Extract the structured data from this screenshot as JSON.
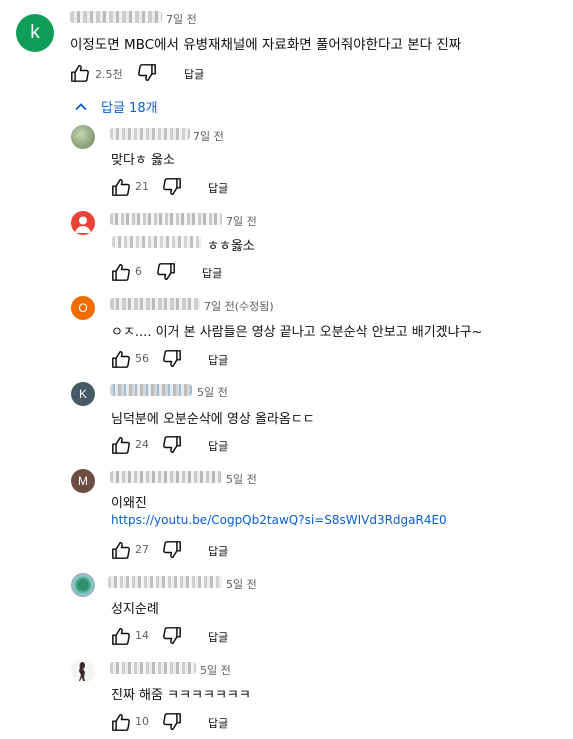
{
  "colors": {
    "link": "#065fd4",
    "meta_text": "#606060",
    "avatar_k_main": "#0f9d58",
    "avatar_red": "#ea4335",
    "avatar_o": "#ef6c00",
    "avatar_k_reply": "#455a64",
    "avatar_m": "#6d4c41"
  },
  "main_comment": {
    "avatar_letter": "k",
    "time": "7일 전",
    "text": "이정도면 MBC에서 유병재채널에 자료화면 풀어줘야한다고 본다 진짜",
    "likes": "2.5천",
    "reply_label": "답글",
    "icons": [
      "thumb-up-icon",
      "thumb-down-icon"
    ]
  },
  "replies_toggle": {
    "label": "답글 18개",
    "icon": "chevron-up-icon"
  },
  "replies": [
    {
      "avatar": "image",
      "time": "7일 전",
      "text": "맞다ㅎ 옳소",
      "likes": "21",
      "reply_label": "답글"
    },
    {
      "avatar": "person-icon",
      "time": "7일 전",
      "text": "ㅎㅎ옳소",
      "likes": "6",
      "reply_label": "답글"
    },
    {
      "avatar_letter": "O",
      "time": "7일 전(수정됨)",
      "text": "ㅇㅈ.... 이거 본 사람들은 영상 끝나고 오분순삭 안보고 배기겠냐구~",
      "likes": "56",
      "reply_label": "답글"
    },
    {
      "avatar_letter": "K",
      "time": "5일 전",
      "text": "님덕분에 오분순삭에 영상 올라옴ㄷㄷ",
      "likes": "24",
      "reply_label": "답글"
    },
    {
      "avatar_letter": "M",
      "time": "5일 전",
      "text": "이왜진",
      "link": "https://youtu.be/CogpQb2tawQ?si=S8sWIVd3RdgaR4E0",
      "likes": "27",
      "reply_label": "답글"
    },
    {
      "avatar": "image",
      "time": "5일 전",
      "text": "성지순례",
      "likes": "14",
      "reply_label": "답글"
    },
    {
      "avatar": "image",
      "time": "5일 전",
      "text": "진짜 해줌 ㅋㅋㅋㅋㅋㅋㅋ",
      "likes": "10",
      "reply_label": "답글"
    }
  ]
}
